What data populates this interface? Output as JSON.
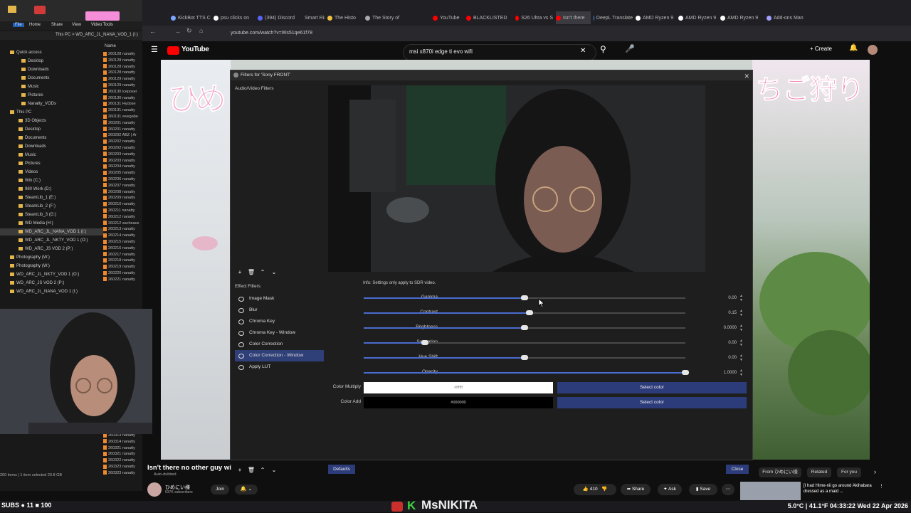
{
  "browser": {
    "tabs": [
      "KickBot TTS C",
      "psu clicks on",
      "(394) Discord",
      "Smart Ring |",
      "The Histo",
      "The Story of",
      "YouTube",
      "BLACKLISTED",
      "S26 Ultra vs S",
      "Isn't there",
      "DeepL Translate",
      "AMD Ryzen 9",
      "AMD Ryzen 9",
      "AMD Ryzen 9",
      "Add-ons Man"
    ],
    "tab_colors": [
      "#7aa6ff",
      "#ffffff",
      "#5865f2",
      "#ff8f3f",
      "#f0c040",
      "#aaaaaa",
      "#ff0000",
      "#ff0000",
      "#ff0000",
      "#ff0000",
      "#4aa0ff",
      "#ffffff",
      "#ffffff",
      "#ffffff",
      "#a0a0ff"
    ],
    "url": "youtube.com/watch?v=Ws51qe61f78"
  },
  "explorer": {
    "ribbon": [
      "File",
      "Home",
      "Share",
      "View",
      "Video Tools"
    ],
    "address": "This PC > WD_ARC_JL_NANA_VOD_1 (I:)",
    "column_header": "Name",
    "nav_items": [
      "Quick access",
      "Desktop",
      "Downloads",
      "Documents",
      "Music",
      "Pictures",
      "Nanatty_VODs",
      "This PC",
      "3D Objects",
      "Desktop",
      "Documents",
      "Downloads",
      "Music",
      "Pictures",
      "Videos",
      "Win (C:)",
      "980 Work (D:)",
      "SteamLib_1 (E:)",
      "SteamLib_2 (F:)",
      "SteamLib_3 (G:)",
      "WD Media (H:)",
      "WD_ARC_JL_NANA_VOD 1 (I:)",
      "WD_ARC_JL_NKTY_VOD 1 (O:)",
      "WD_ARC_JS VOD 2 (P:)",
      "Photography (W:)",
      "Photography (W:)",
      "WD_ARC_JL_NKTY_VOD 1 (O:)",
      "WD_ARC_JS VOD 2 (P:)",
      "WD_ARC_JL_NANA_VOD 1 (I:)"
    ],
    "files": [
      "260128 nanatty",
      "260128 nanatty",
      "260128 nanatty",
      "260128 nanatty",
      "260129 nanatty",
      "260129 nanatty",
      "260130 iceposei",
      "260130 nanatty",
      "260131 Hyobse",
      "260131 nanatty",
      "260131 wvegabe",
      "260201 nanatty",
      "260201 nanatty",
      "260202 ABZ | Ar",
      "260202 nanatty",
      "260202 nanatty",
      "260203 nanatty",
      "260203 nanatty",
      "260204 nanatty",
      "260205 nanatty",
      "260206 nanatty",
      "260207 nanatty",
      "260208 nanatty",
      "260209 nanatty",
      "260210 nanatty",
      "260211 nanatty",
      "260212 nanatty",
      "260212 sacheaux",
      "260213 nanatty",
      "260214 nanatty",
      "260215 nanatty",
      "260216 nanatty",
      "260217 nanatty",
      "260218 nanatty",
      "260219 nanatty",
      "260220 nanatty",
      "260221 nanatty"
    ],
    "files_bottom": [
      "260313 nanatty",
      "260314 nanatty",
      "260321 nanatty",
      "260321 nanatty",
      "260322 nanatty",
      "260323 nanatty",
      "260323 nanatty"
    ],
    "status": "200 items | 1 item selected 20.8 GB"
  },
  "youtube": {
    "logo": "YouTube",
    "search_query": "msi x870i edge ti evo wifi",
    "create_label": "Create",
    "video_title": "Isn't there no other guy wi",
    "auto_dubbed": "Auto-dubbed",
    "channel_name": "ひめにい様",
    "subscribers": "537K subscribers",
    "join_label": "Join",
    "likes": "410",
    "share_label": "Share",
    "ask_label": "Ask",
    "save_label": "Save",
    "rec_tabs": [
      "From ひめにい様",
      "Related",
      "For you"
    ],
    "rec_title": "[I had Hime-nii go around Akihabara dressed as a maid ..."
  },
  "obs": {
    "title": "Filters for 'Sony FRONT'",
    "audio_video_label": "Audio/Video Filters",
    "effect_label": "Effect Filters",
    "effects": [
      "Image Mask",
      "Blur",
      "Chroma Key",
      "Chroma Key - Window",
      "Color Correction",
      "Color Correction - Window",
      "Apply LUT"
    ],
    "selected_effect": "Color Correction - Window",
    "info": "Info: Settings only apply to SDR video.",
    "params": [
      {
        "label": "Gamma",
        "value": "0.00",
        "position": 0.5
      },
      {
        "label": "Contrast",
        "value": "0.15",
        "position": 0.515
      },
      {
        "label": "Brightness",
        "value": "0.0000",
        "position": 0.5
      },
      {
        "label": "Saturation",
        "value": "0.00",
        "position": 0.19
      },
      {
        "label": "Hue Shift",
        "value": "0.00",
        "position": 0.5
      },
      {
        "label": "Opacity",
        "value": "1.0000",
        "position": 1.0
      }
    ],
    "color_multiply_label": "Color Multiply",
    "color_multiply_value": "#ffffff",
    "color_add_label": "Color Add",
    "color_add_value": "#000000",
    "select_color_label": "Select color",
    "defaults_label": "Defaults",
    "close_label": "Close"
  },
  "taskbar": {
    "left": "SUBS ● 11  ■ 100",
    "center": "MsNIKITA",
    "right": "5.0°C | 41.1°F  04:33:22  Wed 22 Apr 2026"
  },
  "colors": {
    "accent": "#4a6bd0",
    "button": "#2c3b79",
    "selected": "#2f3f78"
  }
}
